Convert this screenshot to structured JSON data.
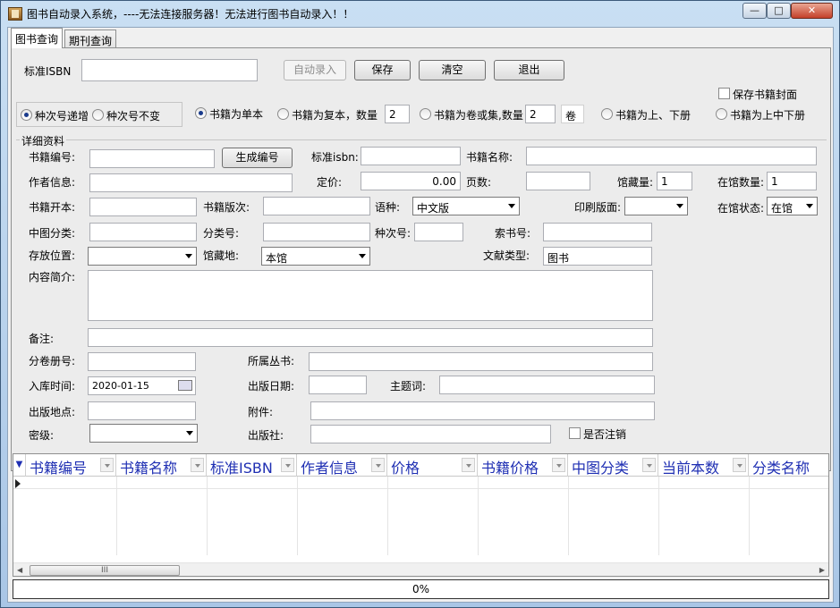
{
  "window": {
    "title": "图书自动录入系统，----无法连接服务器！无法进行图书自动录入！！",
    "minimize_label": "—",
    "maximize_label": "□",
    "close_label": "✕"
  },
  "tabs": [
    {
      "label": "图书查询",
      "active": true
    },
    {
      "label": "期刊查询",
      "active": false
    }
  ],
  "isbn_row": {
    "label": "标准ISBN",
    "value": "",
    "auto_entry_label": "自动录入",
    "save_label": "保存",
    "clear_label": "清空",
    "exit_label": "退出"
  },
  "save_cover": {
    "label": "保存书籍封面",
    "checked": false
  },
  "sequence_mode": {
    "increment_label": "种次号递增",
    "fixed_label": "种次号不变",
    "selected": "increment"
  },
  "volume_mode": {
    "single_label": "书籍为单本",
    "multi_label": "书籍为复本，数量",
    "multi_qty": "2",
    "set_label": "书籍为卷或集,数量",
    "set_qty": "2",
    "set_unit": "卷",
    "two_vol_label": "书籍为上、下册",
    "three_vol_label": "书籍为上中下册",
    "selected": "single"
  },
  "details": {
    "group_label": "详细资料",
    "book_no_label": "书籍编号:",
    "book_no_value": "",
    "generate_label": "生成编号",
    "isbn_label": "标准isbn:",
    "isbn_value": "",
    "title_label": "书籍名称:",
    "title_value": "",
    "author_label": "作者信息:",
    "author_value": "",
    "price_label": "定价:",
    "price_value": "0.00",
    "pages_label": "页数:",
    "pages_value": "",
    "holdings_label": "馆藏量:",
    "holdings_value": "1",
    "in_lib_qty_label": "在馆数量:",
    "in_lib_qty_value": "1",
    "format_label": "书籍开本:",
    "format_value": "",
    "edition_label": "书籍版次:",
    "edition_value": "",
    "language_label": "语种:",
    "language_value": "中文版",
    "print_label": "印刷版面:",
    "print_value": "",
    "status_label": "在馆状态:",
    "status_value": "在馆",
    "clc_label": "中图分类:",
    "clc_value": "",
    "class_no_label": "分类号:",
    "class_no_value": "",
    "seq_no_label": "种次号:",
    "seq_no_value": "",
    "call_no_label": "索书号:",
    "call_no_value": "",
    "location_label": "存放位置:",
    "location_value": "",
    "site_label": "馆藏地:",
    "site_value": "本馆",
    "doc_type_label": "文献类型:",
    "doc_type_value": "图书",
    "summary_label": "内容简介:",
    "summary_value": "",
    "remark_label": "备注:",
    "remark_value": "",
    "volume_no_label": "分卷册号:",
    "volume_no_value": "",
    "series_label": "所属丛书:",
    "series_value": "",
    "entry_date_label": "入库时间:",
    "entry_date_value": "2020-01-15",
    "pub_date_label": "出版日期:",
    "pub_date_value": "",
    "subject_label": "主题词:",
    "subject_value": "",
    "pub_place_label": "出版地点:",
    "pub_place_value": "",
    "attachment_label": "附件:",
    "attachment_value": "",
    "secrecy_label": "密级:",
    "secrecy_value": "",
    "publisher_label": "出版社:",
    "publisher_value": "",
    "cancelled": {
      "label": "是否注销",
      "checked": false
    }
  },
  "grid": {
    "columns": [
      "书籍编号",
      "书籍名称",
      "标准ISBN",
      "作者信息",
      "价格",
      "书籍价格",
      "中图分类",
      "当前本数",
      "分类名称"
    ],
    "rows": [],
    "scroll_thumb": "III"
  },
  "progress": {
    "text": "0%",
    "value": 0
  },
  "colors": {
    "header_text": "#1f2fb3",
    "titlebar": "#b9d1ea"
  }
}
